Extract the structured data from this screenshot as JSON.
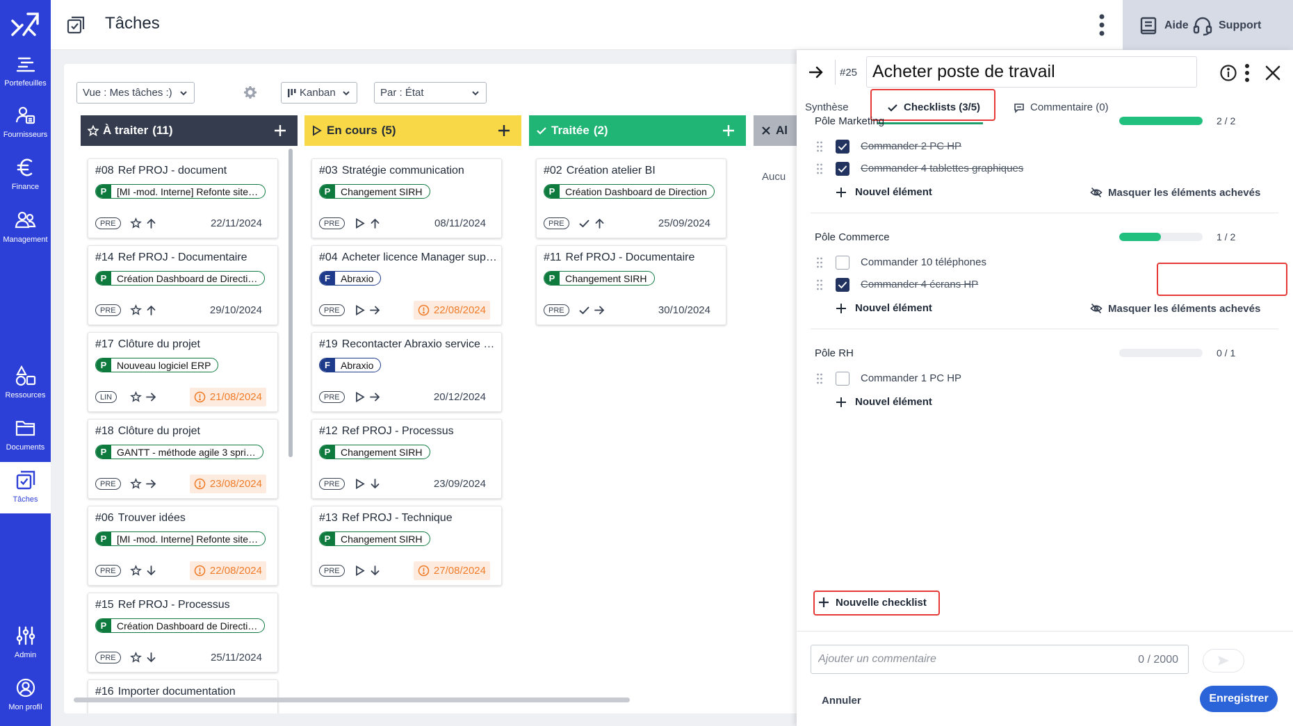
{
  "colors": {
    "nav_bg": "#2c3fd6",
    "todo_header": "#353c4d",
    "inprogress_header": "#f9d847",
    "done_header": "#20b574",
    "abandoned_header": "#b0b4bc",
    "progress_fill": "#22c07e",
    "late_text": "#f07c28",
    "save_button": "#2b63d9",
    "highlight_red": "#e53935"
  },
  "nav": {
    "items": [
      {
        "label": "Portefeuilles",
        "icon": "portfolio-icon"
      },
      {
        "label": "Fournisseurs",
        "icon": "supplier-icon"
      },
      {
        "label": "Finance",
        "icon": "euro-icon"
      },
      {
        "label": "Management",
        "icon": "people-icon"
      },
      {
        "label": "Ressources",
        "icon": "resources-icon"
      },
      {
        "label": "Documents",
        "icon": "folder-icon"
      },
      {
        "label": "Tâches",
        "icon": "tasks-icon"
      },
      {
        "label": "Admin",
        "icon": "sliders-icon"
      },
      {
        "label": "Mon profil",
        "icon": "profile-icon"
      }
    ],
    "active": "Tâches"
  },
  "header": {
    "title": "Tâches",
    "help_label": "Aide",
    "support_label": "Support"
  },
  "filters": {
    "view": "Vue : Mes tâches :)",
    "mode": "Kanban",
    "group_by": "Par : État"
  },
  "columns": [
    {
      "title": "À traiter",
      "count": "(11)",
      "cards": [
        {
          "id": "#08",
          "title": "Ref PROJ - document",
          "project_type": "P",
          "project": "[MI -mod. Interne] Refonte site…",
          "badge": "PRE",
          "date": "22/11/2024",
          "late": false
        },
        {
          "id": "#14",
          "title": "Ref PROJ - Documentaire",
          "project_type": "P",
          "project": "Création Dashboard de Directi…",
          "badge": "PRE",
          "date": "29/10/2024",
          "late": false
        },
        {
          "id": "#17",
          "title": "Clôture du projet",
          "project_type": "P",
          "project": "Nouveau logiciel ERP",
          "badge": "LIN",
          "date": "21/08/2024",
          "late": true
        },
        {
          "id": "#18",
          "title": "Clôture du projet",
          "project_type": "P",
          "project": "GANTT - méthode agile 3 spri…",
          "badge": "PRE",
          "date": "23/08/2024",
          "late": true
        },
        {
          "id": "#06",
          "title": "Trouver idées",
          "project_type": "P",
          "project": "[MI -mod. Interne] Refonte site…",
          "badge": "PRE",
          "date": "22/08/2024",
          "late": true
        },
        {
          "id": "#15",
          "title": "Ref PROJ - Processus",
          "project_type": "P",
          "project": "Création Dashboard de Directi…",
          "badge": "PRE",
          "date": "25/11/2024",
          "late": false
        },
        {
          "id": "#16",
          "title": "Importer documentation",
          "project_type": "",
          "project": "",
          "badge": "",
          "date": "",
          "late": false
        }
      ]
    },
    {
      "title": "En cours",
      "count": "(5)",
      "cards": [
        {
          "id": "#03",
          "title": "Stratégie communication",
          "project_type": "P",
          "project": "Changement SIRH",
          "badge": "PRE",
          "date": "08/11/2024",
          "late": false
        },
        {
          "id": "#04",
          "title": "Acheter licence Manager sup…",
          "project_type": "F",
          "project": "Abraxio",
          "badge": "PRE",
          "date": "22/08/2024",
          "late": true
        },
        {
          "id": "#19",
          "title": "Recontacter Abraxio service …",
          "project_type": "F",
          "project": "Abraxio",
          "badge": "PRE",
          "date": "20/12/2024",
          "late": false
        },
        {
          "id": "#12",
          "title": "Ref PROJ - Processus",
          "project_type": "P",
          "project": "Changement SIRH",
          "badge": "PRE",
          "date": "23/09/2024",
          "late": false
        },
        {
          "id": "#13",
          "title": "Ref PROJ - Technique",
          "project_type": "P",
          "project": "Changement SIRH",
          "badge": "PRE",
          "date": "27/08/2024",
          "late": true
        }
      ]
    },
    {
      "title": "Traitée",
      "count": "(2)",
      "cards": [
        {
          "id": "#02",
          "title": "Création atelier BI",
          "project_type": "P",
          "project": "Création Dashboard de Direction",
          "badge": "PRE",
          "date": "25/09/2024",
          "late": false
        },
        {
          "id": "#11",
          "title": "Ref PROJ - Documentaire",
          "project_type": "P",
          "project": "Changement SIRH",
          "badge": "PRE",
          "date": "30/10/2024",
          "late": false
        }
      ]
    },
    {
      "title": "Al",
      "count": "",
      "empty_text": "Aucu"
    }
  ],
  "detail": {
    "task_id": "#25",
    "task_title": "Acheter poste de travail",
    "tabs": {
      "synthese": "Synthèse",
      "checklists": "Checklists (3/5)",
      "comments": "Commentaire (0)"
    },
    "add_item_label": "Nouvel élément",
    "hide_done_label": "Masquer les éléments achevés",
    "checklists": [
      {
        "title": "Pôle Marketing",
        "count": "2 / 2",
        "progress": 1.0,
        "items": [
          {
            "label": "Commander 2 PC HP",
            "done": true
          },
          {
            "label": "Commander 4 tablettes graphiques",
            "done": true
          }
        ]
      },
      {
        "title": "Pôle Commerce",
        "count": "1 / 2",
        "progress": 0.5,
        "items": [
          {
            "label": "Commander 10 téléphones",
            "done": false
          },
          {
            "label": "Commander 4 écrans HP",
            "done": true
          }
        ]
      },
      {
        "title": "Pôle RH",
        "count": "0 / 1",
        "progress": 0.0,
        "items": [
          {
            "label": "Commander 1 PC HP",
            "done": false
          }
        ]
      }
    ],
    "new_checklist_label": "Nouvelle checklist",
    "comment_placeholder": "Ajouter un commentaire",
    "comment_count": "0 / 2000",
    "cancel_label": "Annuler",
    "save_label": "Enregistrer"
  }
}
